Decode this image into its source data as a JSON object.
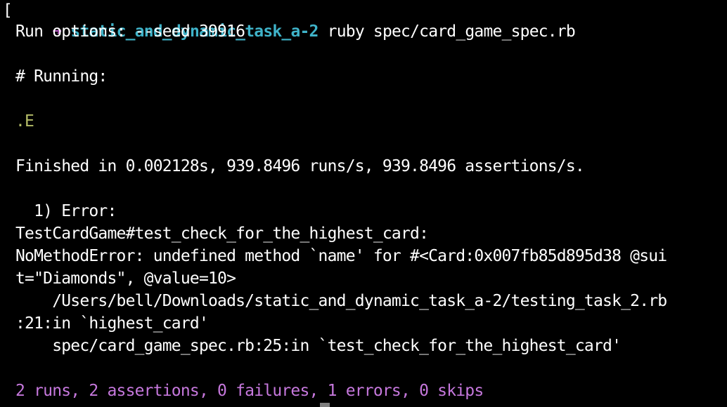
{
  "prompt": {
    "open_bracket": "[",
    "arrow": "➜",
    "directory": "static_and_dynamic_task_a-2",
    "command": "ruby spec/card_game_spec.rb"
  },
  "output": {
    "run_options": "Run options: --seed 39916",
    "running_header": "# Running:",
    "progress": ".E",
    "finished": "Finished in 0.002128s, 939.8496 runs/s, 939.8496 assertions/s.",
    "error_heading": "  1) Error:",
    "test_name": "TestCardGame#test_check_for_the_highest_card:",
    "error_message_1": "NoMethodError: undefined method `name' for #<Card:0x007fb85d895d38 @sui",
    "error_message_2": "t=\"Diamonds\", @value=10>",
    "trace_1a": "    /Users/bell/Downloads/static_and_dynamic_task_a-2/testing_task_2.rb",
    "trace_1b": ":21:in `highest_card'",
    "trace_2": "    spec/card_game_spec.rb:25:in `test_check_for_the_highest_card'",
    "summary": "2 runs, 2 assertions, 0 failures, 1 errors, 0 skips"
  },
  "colors": {
    "background": "#000000",
    "text": "#ffffff",
    "arrow": "#c061cb",
    "directory": "#3fb3c9",
    "progress": "#b5bd68",
    "summary": "#c678dd",
    "cursor": "#7f7f7f"
  }
}
